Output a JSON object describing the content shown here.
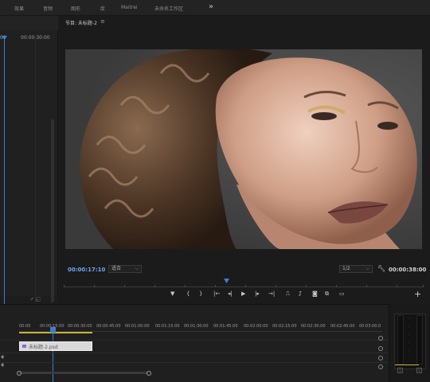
{
  "workspace_tabs": [
    "效果",
    "音频",
    "图形",
    "库",
    "Maitrei",
    "未命名工作区"
  ],
  "workspace_more": "»",
  "source_panel": {
    "timecode_current": "00",
    "timecode_next": "00:00:30:00"
  },
  "program_monitor": {
    "title": "节目: 未标题-2",
    "menu_glyph": "≡",
    "timecode_current": "00:00:17:10",
    "fit_option": "适合",
    "resolution_option": "1/2",
    "timecode_total": "00:00:38:00"
  },
  "transport_controls": [
    {
      "name": "add-marker-icon",
      "glyph": "▼"
    },
    {
      "name": "mark-in-icon",
      "glyph": "{"
    },
    {
      "name": "mark-out-icon",
      "glyph": "}"
    },
    {
      "name": "go-to-in-icon",
      "glyph": "|←"
    },
    {
      "name": "step-back-icon",
      "glyph": "◂|"
    },
    {
      "name": "play-icon",
      "glyph": "▶"
    },
    {
      "name": "step-forward-icon",
      "glyph": "|▸"
    },
    {
      "name": "go-to-out-icon",
      "glyph": "→|"
    },
    {
      "name": "lift-icon",
      "glyph": "⎍"
    },
    {
      "name": "extract-icon",
      "glyph": "⎎"
    },
    {
      "name": "export-frame-icon",
      "glyph": "◙"
    },
    {
      "name": "comparison-view-icon",
      "glyph": "⧉"
    },
    {
      "name": "safe-margins-icon",
      "glyph": "▭"
    }
  ],
  "add_button_glyph": "+",
  "timeline": {
    "ruler": [
      "00:00",
      "00:00:15:00",
      "00:00:30:00",
      "00:00:45:00",
      "00:01:00:00",
      "00:01:15:00",
      "00:01:30:00",
      "00:01:45:00",
      "00:02:00:00",
      "00:02:15:00",
      "00:02:30:00",
      "00:02:45:00",
      "00:03:00:0"
    ],
    "clip_label": "未标题-2.psd"
  },
  "colors": {
    "accent_blue": "#3d7ed0",
    "timecode_blue": "#6ea6f0",
    "work_area_yellow": "#c6b33a"
  }
}
